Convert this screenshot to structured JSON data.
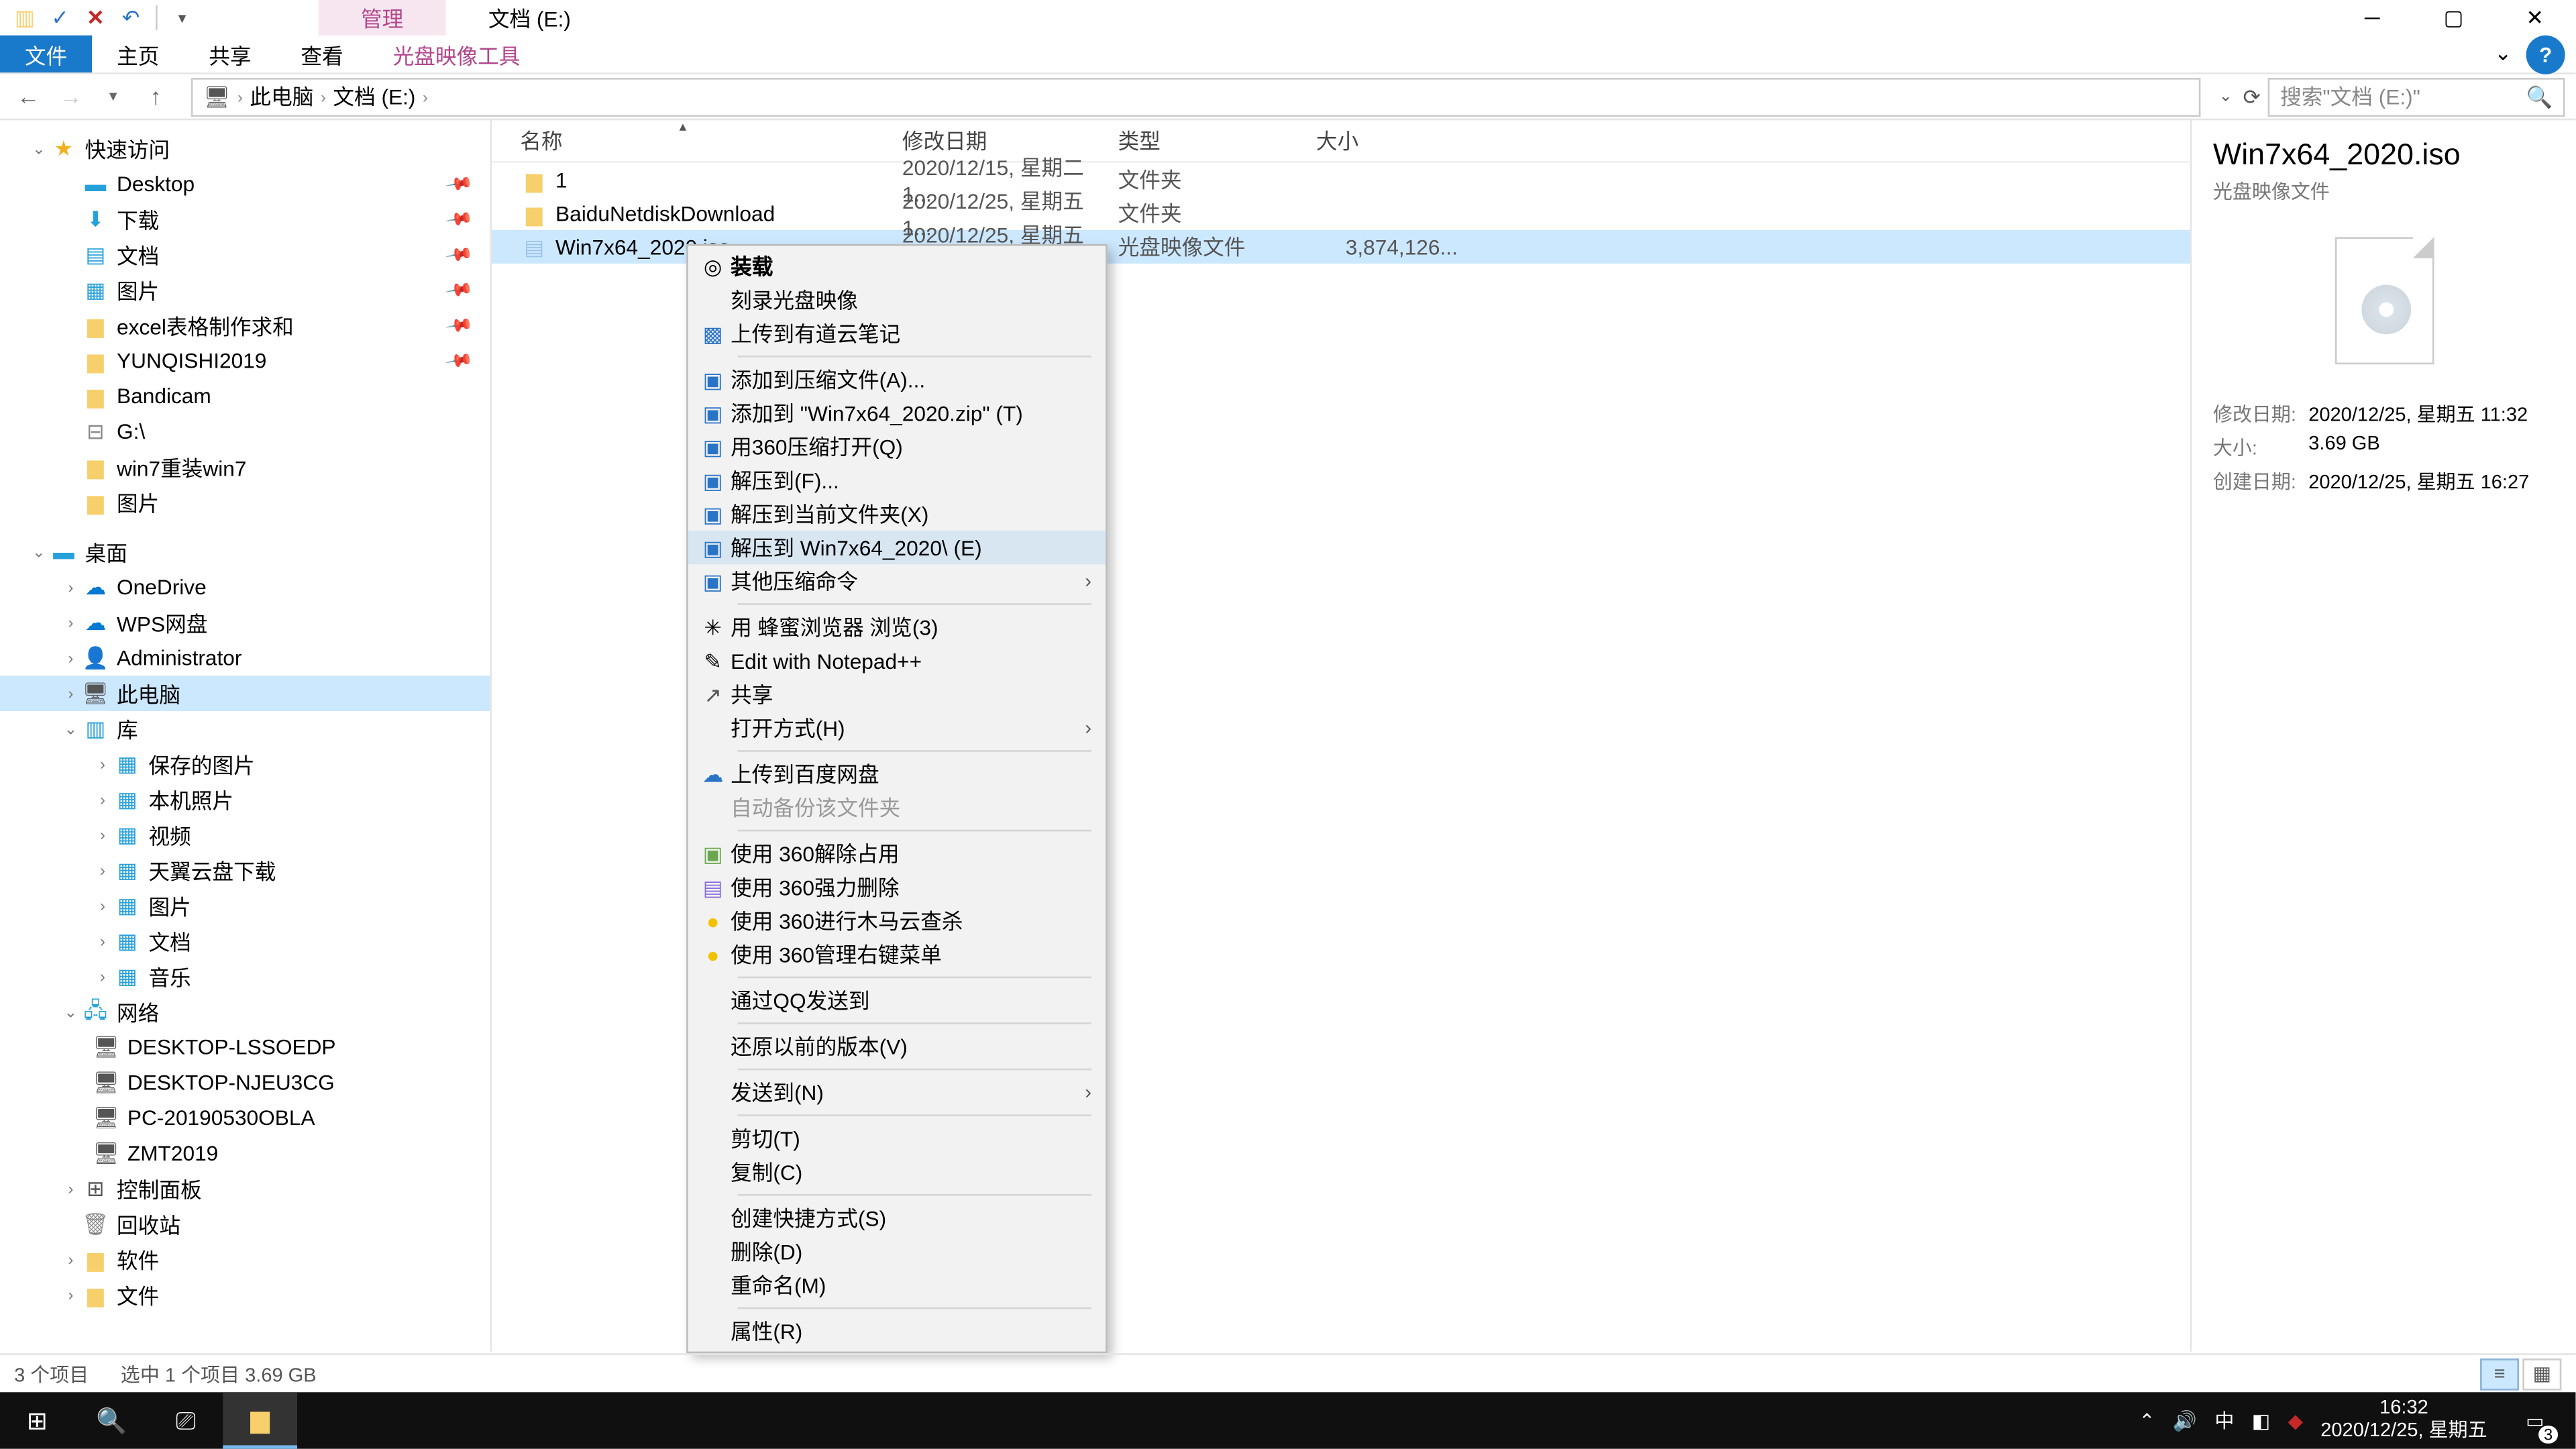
{
  "qat": {
    "title_tab_active": "管理",
    "title_tab_right": "文档 (E:)"
  },
  "ribbon": {
    "file": "文件",
    "tabs": [
      "主页",
      "共享",
      "查看",
      "光盘映像工具"
    ]
  },
  "breadcrumb": {
    "root": "此电脑",
    "leaf": "文档 (E:)"
  },
  "search": {
    "placeholder": "搜索\"文档 (E:)\""
  },
  "columns": {
    "name": "名称",
    "date": "修改日期",
    "type": "类型",
    "size": "大小"
  },
  "tree": {
    "quick": "快速访问",
    "quick_items": [
      "Desktop",
      "下载",
      "文档",
      "图片",
      "excel表格制作求和",
      "YUNQISHI2019",
      "Bandicam",
      "G:\\",
      "win7重装win7",
      "图片"
    ],
    "desktop": "桌面",
    "desktop_items": [
      "OneDrive",
      "WPS网盘",
      "Administrator",
      "此电脑",
      "库"
    ],
    "lib_items": [
      "保存的图片",
      "本机照片",
      "视频",
      "天翼云盘下载",
      "图片",
      "文档",
      "音乐"
    ],
    "network": "网络",
    "network_items": [
      "DESKTOP-LSSOEDP",
      "DESKTOP-NJEU3CG",
      "PC-20190530OBLA",
      "ZMT2019"
    ],
    "tail": [
      "控制面板",
      "回收站",
      "软件",
      "文件"
    ]
  },
  "rows": [
    {
      "name": "1",
      "date": "2020/12/15, 星期二 1...",
      "type": "文件夹",
      "size": ""
    },
    {
      "name": "BaiduNetdiskDownload",
      "date": "2020/12/25, 星期五 1...",
      "type": "文件夹",
      "size": ""
    },
    {
      "name": "Win7x64_2020.iso",
      "date": "2020/12/25, 星期五 1...",
      "type": "光盘映像文件",
      "size": "3,874,126..."
    }
  ],
  "ctx": [
    {
      "icon": "disc",
      "label": "装载",
      "bold": true
    },
    {
      "icon": "",
      "label": "刻录光盘映像"
    },
    {
      "icon": "note",
      "label": "上传到有道云笔记"
    },
    {
      "sep": true
    },
    {
      "icon": "arc",
      "label": "添加到压缩文件(A)..."
    },
    {
      "icon": "arc",
      "label": "添加到 \"Win7x64_2020.zip\" (T)"
    },
    {
      "icon": "arc",
      "label": "用360压缩打开(Q)"
    },
    {
      "icon": "arc",
      "label": "解压到(F)..."
    },
    {
      "icon": "arc",
      "label": "解压到当前文件夹(X)"
    },
    {
      "icon": "arc",
      "label": "解压到 Win7x64_2020\\ (E)",
      "hl": true
    },
    {
      "icon": "arc",
      "label": "其他压缩命令",
      "submenu": true
    },
    {
      "sep": true
    },
    {
      "icon": "bee",
      "label": "用 蜂蜜浏览器 浏览(3)"
    },
    {
      "icon": "npp",
      "label": "Edit with Notepad++"
    },
    {
      "icon": "share",
      "label": "共享"
    },
    {
      "icon": "",
      "label": "打开方式(H)",
      "submenu": true
    },
    {
      "sep": true
    },
    {
      "icon": "bd",
      "label": "上传到百度网盘"
    },
    {
      "icon": "",
      "label": "自动备份该文件夹",
      "disabled": true
    },
    {
      "sep": true
    },
    {
      "icon": "s360a",
      "label": "使用 360解除占用"
    },
    {
      "icon": "s360b",
      "label": "使用 360强力删除"
    },
    {
      "icon": "s360c",
      "label": "使用 360进行木马云查杀"
    },
    {
      "icon": "s360c",
      "label": "使用 360管理右键菜单"
    },
    {
      "sep": true
    },
    {
      "icon": "",
      "label": "通过QQ发送到"
    },
    {
      "sep": true
    },
    {
      "icon": "",
      "label": "还原以前的版本(V)"
    },
    {
      "sep": true
    },
    {
      "icon": "",
      "label": "发送到(N)",
      "submenu": true
    },
    {
      "sep": true
    },
    {
      "icon": "",
      "label": "剪切(T)"
    },
    {
      "icon": "",
      "label": "复制(C)"
    },
    {
      "sep": true
    },
    {
      "icon": "",
      "label": "创建快捷方式(S)"
    },
    {
      "icon": "",
      "label": "删除(D)"
    },
    {
      "icon": "",
      "label": "重命名(M)"
    },
    {
      "sep": true
    },
    {
      "icon": "",
      "label": "属性(R)"
    }
  ],
  "details": {
    "title": "Win7x64_2020.iso",
    "subtitle": "光盘映像文件",
    "props": [
      {
        "k": "修改日期:",
        "v": "2020/12/25, 星期五 11:32"
      },
      {
        "k": "大小:",
        "v": "3.69 GB"
      },
      {
        "k": "创建日期:",
        "v": "2020/12/25, 星期五 16:27"
      }
    ]
  },
  "status": {
    "count": "3 个项目",
    "sel": "选中 1 个项目  3.69 GB"
  },
  "tray": {
    "ime": "中",
    "time": "16:32",
    "date": "2020/12/25, 星期五",
    "notif_count": "3"
  }
}
